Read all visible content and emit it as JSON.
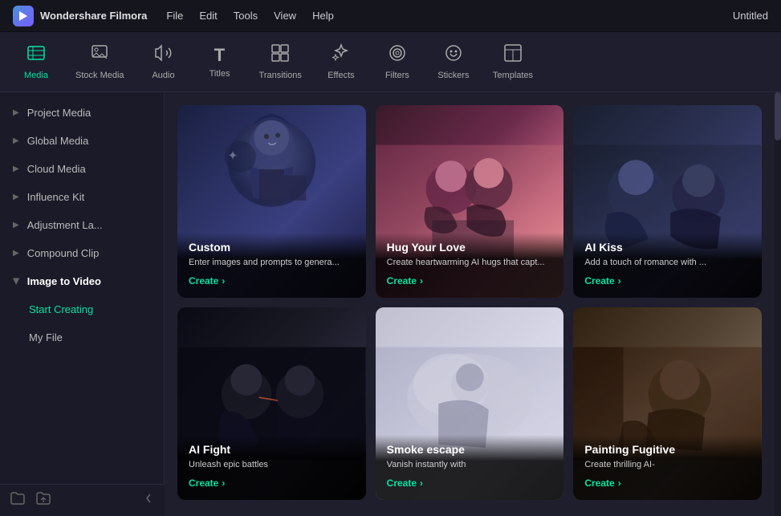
{
  "titlebar": {
    "app_name": "Wondershare Filmora",
    "menu": [
      "File",
      "Edit",
      "Tools",
      "View",
      "Help"
    ],
    "project_name": "Untitled"
  },
  "toolbar": {
    "items": [
      {
        "id": "media",
        "label": "Media",
        "icon": "🎬",
        "active": true
      },
      {
        "id": "stock-media",
        "label": "Stock Media",
        "icon": "🖼️",
        "active": false
      },
      {
        "id": "audio",
        "label": "Audio",
        "icon": "🎵",
        "active": false
      },
      {
        "id": "titles",
        "label": "Titles",
        "icon": "T",
        "active": false
      },
      {
        "id": "transitions",
        "label": "Transitions",
        "icon": "⊞",
        "active": false
      },
      {
        "id": "effects",
        "label": "Effects",
        "icon": "✦",
        "active": false
      },
      {
        "id": "filters",
        "label": "Filters",
        "icon": "◎",
        "active": false
      },
      {
        "id": "stickers",
        "label": "Stickers",
        "icon": "☺",
        "active": false
      },
      {
        "id": "templates",
        "label": "Templates",
        "icon": "▦",
        "active": false
      }
    ]
  },
  "sidebar": {
    "items": [
      {
        "id": "project-media",
        "label": "Project Media",
        "expanded": false
      },
      {
        "id": "global-media",
        "label": "Global Media",
        "expanded": false
      },
      {
        "id": "cloud-media",
        "label": "Cloud Media",
        "expanded": false
      },
      {
        "id": "influence-kit",
        "label": "Influence Kit",
        "expanded": false
      },
      {
        "id": "adjustment-la",
        "label": "Adjustment La...",
        "expanded": false
      },
      {
        "id": "compound-clip",
        "label": "Compound Clip",
        "expanded": false
      },
      {
        "id": "image-to-video",
        "label": "Image to Video",
        "expanded": true
      },
      {
        "id": "start-creating",
        "label": "Start Creating",
        "sub": true,
        "active": true
      },
      {
        "id": "my-file",
        "label": "My File",
        "sub": true,
        "active": false
      }
    ]
  },
  "cards": [
    {
      "id": "custom",
      "title": "Custom",
      "description": "Enter images and prompts to genera...",
      "create_label": "Create",
      "bg_class": "card-bg-wizard"
    },
    {
      "id": "hug-your-love",
      "title": "Hug Your Love",
      "description": "Create heartwarming AI hugs that capt...",
      "create_label": "Create",
      "bg_class": "card-bg-hug"
    },
    {
      "id": "ai-kiss",
      "title": "AI Kiss",
      "description": "Add a touch of romance with ...",
      "create_label": "Create",
      "bg_class": "card-bg-kiss"
    },
    {
      "id": "ai-fight",
      "title": "AI Fight",
      "description": "Unleash epic battles",
      "create_label": "Create",
      "bg_class": "card-bg-fight"
    },
    {
      "id": "smoke-escape",
      "title": "Smoke escape",
      "description": "Vanish instantly with",
      "create_label": "Create",
      "bg_class": "card-bg-smoke"
    },
    {
      "id": "painting-fugitive",
      "title": "Painting Fugitive",
      "description": "Create thrilling AI-",
      "create_label": "Create",
      "bg_class": "card-bg-painting"
    }
  ],
  "colors": {
    "accent": "#00e5a0",
    "bg_dark": "#1a1a28",
    "bg_medium": "#1e1e2c"
  }
}
